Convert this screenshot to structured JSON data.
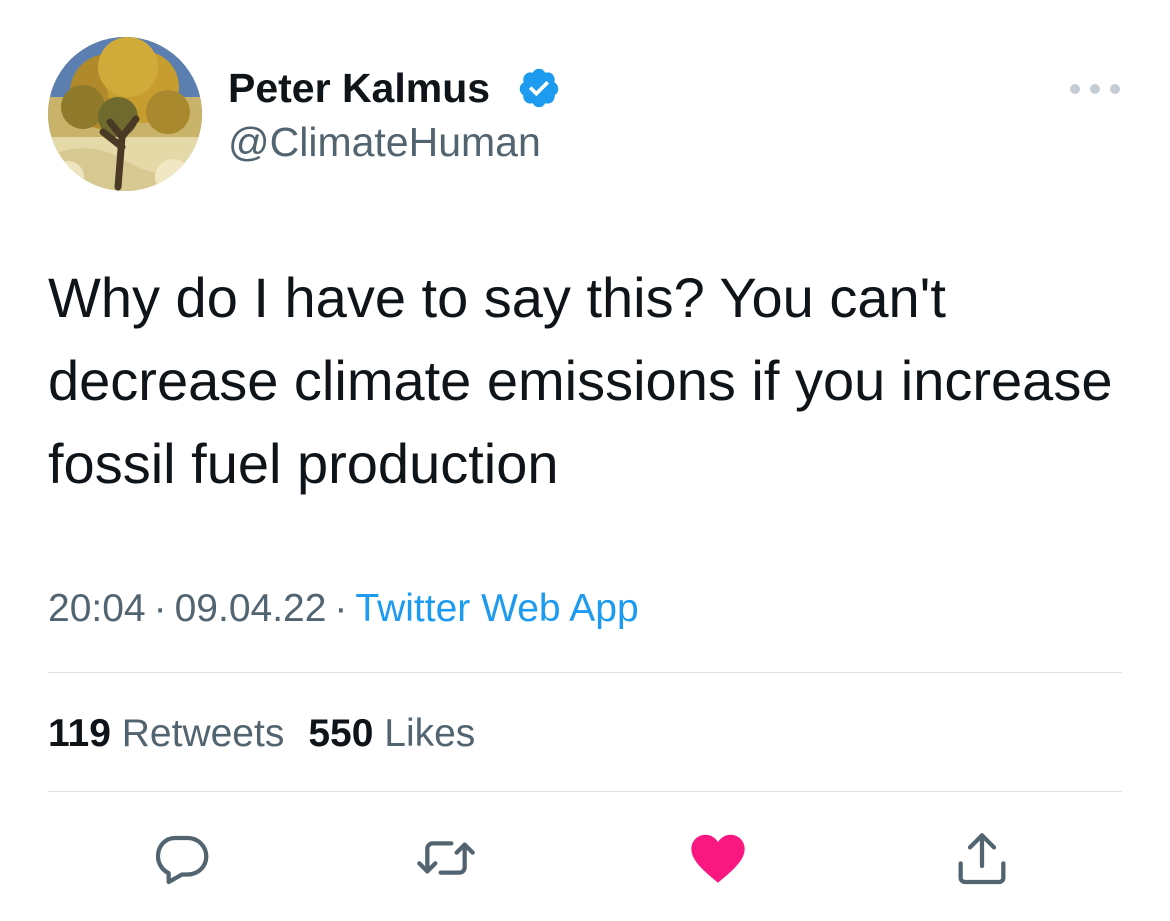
{
  "user": {
    "display_name": "Peter Kalmus",
    "handle": "@ClimateHuman",
    "verified": true,
    "avatar_icon": "tree-painting-avatar"
  },
  "tweet": {
    "text": "Why do I have to say this? You can't decrease climate emissions if you increase fossil fuel production",
    "time": "20:04",
    "date": "09.04.22",
    "separator": "·",
    "source": "Twitter Web App"
  },
  "stats": {
    "retweets_count": "119",
    "retweets_label": "Retweets",
    "likes_count": "550",
    "likes_label": "Likes"
  },
  "actions": {
    "reply_icon": "reply-icon",
    "retweet_icon": "retweet-icon",
    "like_icon": "heart-icon",
    "share_icon": "share-icon",
    "liked": true
  },
  "colors": {
    "accent": "#1d9bf0",
    "verified": "#1d9bf0",
    "like": "#f91880",
    "secondary_text": "#536471",
    "primary_text": "#0f1419",
    "divider": "#dfe3e6"
  }
}
